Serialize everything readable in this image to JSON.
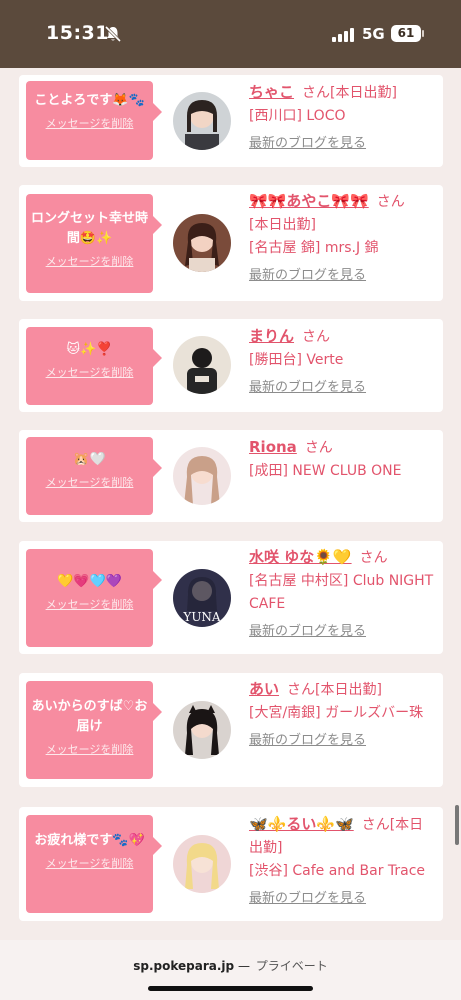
{
  "status_bar": {
    "time": "15:31",
    "network": "5G",
    "battery": "61"
  },
  "cards": [
    {
      "message": "ことよろです🦊🐾",
      "delete_label": "メッセージを削除",
      "name": "ちゃこ",
      "honorific": "さん",
      "status": "[本日出勤]",
      "shop": "[西川口] LOCO",
      "blog_label": "最新のブログを見る"
    },
    {
      "message": "ロングセット幸せ時間🤩✨",
      "delete_label": "メッセージを削除",
      "name": "🎀🎀あやこ🎀🎀",
      "honorific": "さん",
      "status": "[本日出勤]",
      "shop": "[名古屋 錦] mrs.J 錦",
      "blog_label": "最新のブログを見る"
    },
    {
      "message": "🐱✨❣️",
      "delete_label": "メッセージを削除",
      "name": "まりん",
      "honorific": "さん",
      "status": "",
      "shop": "[勝田台] Verte",
      "blog_label": "最新のブログを見る"
    },
    {
      "message": "🐹🤍",
      "delete_label": "メッセージを削除",
      "name": "Riona",
      "honorific": "さん",
      "status": "",
      "shop": "[成田] NEW CLUB ONE",
      "blog_label": "最新のブログを見る"
    },
    {
      "message": "💛💗🩵💜",
      "delete_label": "メッセージを削除",
      "name": "水咲 ゆな🌻💛",
      "honorific": "さん",
      "status": "",
      "shop": "[名古屋 中村区] Club NIGHT CAFE",
      "blog_label": "最新のブログを見る"
    },
    {
      "message": "あいからのすば♡お届け",
      "delete_label": "メッセージを削除",
      "name": "あい",
      "honorific": "さん",
      "status": "[本日出勤]",
      "shop": "[大宮/南銀] ガールズバー珠",
      "blog_label": "最新のブログを見る"
    },
    {
      "message": "お疲れ様です🐾💖",
      "delete_label": "メッセージを削除",
      "name": "🦋⚜️るい⚜️🦋",
      "honorific": "さん",
      "status": "[本日出勤]",
      "shop": "[渋谷] Cafe and Bar Trace",
      "blog_label": "最新のブログを見る"
    }
  ],
  "browser": {
    "host": "sp.pokepara.jp",
    "separator": "—",
    "mode": "プライベート"
  },
  "colors": {
    "accent_pink": "#f78ca0",
    "name_pink": "#e2546c",
    "status_bar": "#5b4a3c"
  }
}
